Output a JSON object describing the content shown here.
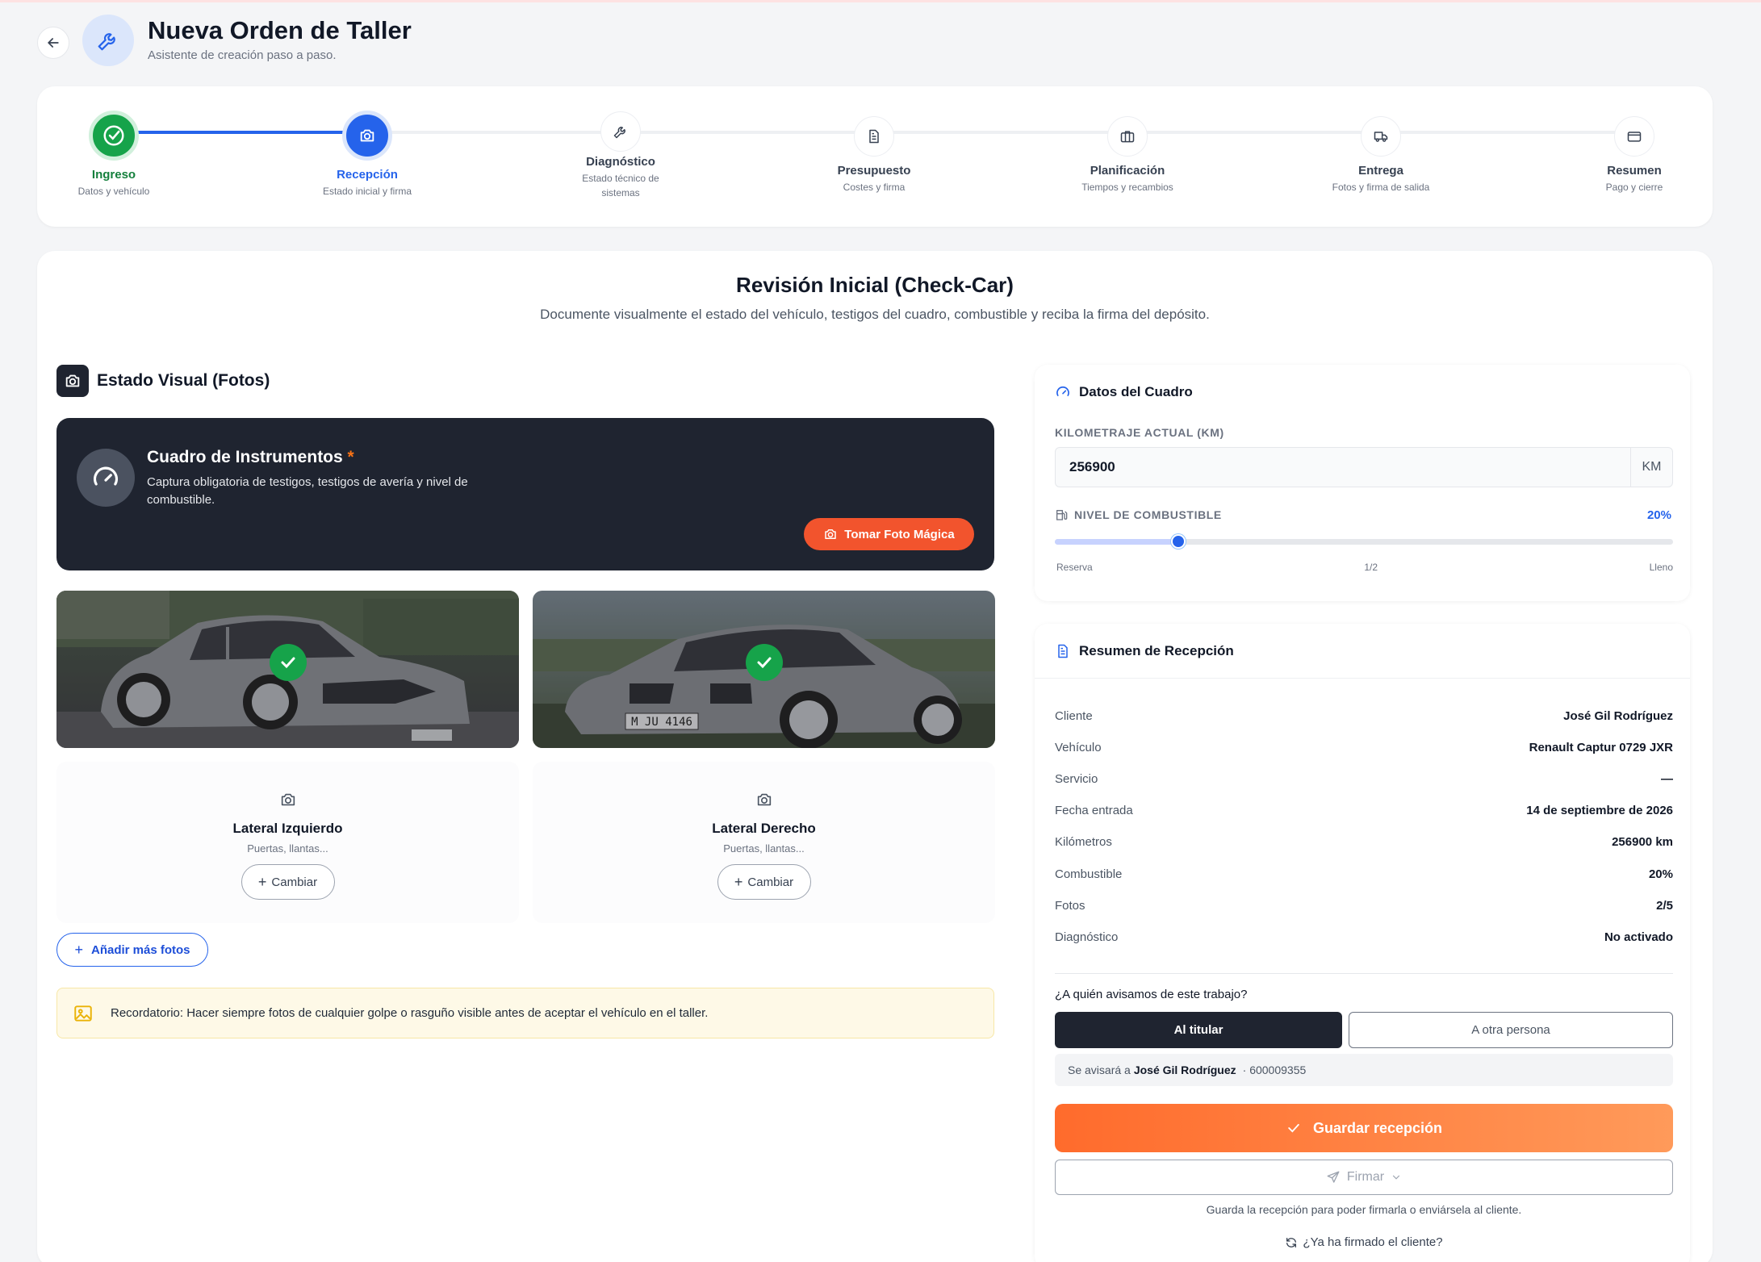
{
  "header": {
    "title": "Nueva Orden de Taller",
    "subtitle": "Asistente de creación paso a paso."
  },
  "steps": [
    {
      "label": "Ingreso",
      "desc": "Datos y vehículo",
      "state": "completed",
      "icon": "check-circle-icon"
    },
    {
      "label": "Recepción",
      "desc": "Estado inicial y firma",
      "state": "active",
      "icon": "camera-icon"
    },
    {
      "label": "Diagnóstico",
      "desc": "Estado técnico de sistemas",
      "state": "pending",
      "icon": "wrench-icon"
    },
    {
      "label": "Presupuesto",
      "desc": "Costes y firma",
      "state": "pending",
      "icon": "document-icon"
    },
    {
      "label": "Planificación",
      "desc": "Tiempos y recambios",
      "state": "pending",
      "icon": "briefcase-icon"
    },
    {
      "label": "Entrega",
      "desc": "Fotos y firma de salida",
      "state": "pending",
      "icon": "truck-icon"
    },
    {
      "label": "Resumen",
      "desc": "Pago y cierre",
      "state": "pending",
      "icon": "card-icon"
    }
  ],
  "main": {
    "title": "Revisión Inicial (Check-Car)",
    "subtitle": "Documente visualmente el estado del vehículo, testigos del cuadro, combustible y reciba la firma del depósito."
  },
  "photos_section": {
    "title": "Estado Visual (Fotos)",
    "dashboard": {
      "title": "Cuadro de Instrumentos",
      "required_mark": "*",
      "desc": "Captura obligatoria de testigos, testigos de avería y nivel de combustible.",
      "button": "Tomar Foto Mágica"
    },
    "slots": [
      {
        "title": "Lateral Izquierdo",
        "sub": "Puertas, llantas...",
        "button": "Cambiar"
      },
      {
        "title": "Lateral Derecho",
        "sub": "Puertas, llantas...",
        "button": "Cambiar"
      }
    ],
    "plate_text": "M JU 4146",
    "add_button": "Añadir más fotos",
    "reminder": "Recordatorio: Hacer siempre fotos de cualquier golpe o rasguño visible antes de aceptar el vehículo en el taller."
  },
  "dash_data": {
    "title": "Datos del Cuadro",
    "km_label": "KILOMETRAJE ACTUAL (KM)",
    "km_value": "256900",
    "km_unit": "KM",
    "fuel_label": "NIVEL DE COMBUSTIBLE",
    "fuel_pct_label": "20%",
    "fuel_fraction": 0.2,
    "ticks": [
      "Reserva",
      "1/2",
      "Lleno"
    ]
  },
  "summary": {
    "title": "Resumen de Recepción",
    "rows": [
      {
        "k": "Cliente",
        "v": "José Gil Rodríguez"
      },
      {
        "k": "Vehículo",
        "v": "Renault Captur 0729 JXR"
      },
      {
        "k": "Servicio",
        "v": "—"
      },
      {
        "k": "Fecha entrada",
        "v": "14 de septiembre de 2026"
      },
      {
        "k": "Kilómetros",
        "v": "256900 km"
      },
      {
        "k": "Combustible",
        "v": "20%"
      },
      {
        "k": "Fotos",
        "v": "2/5"
      },
      {
        "k": "Diagnóstico",
        "v": "No activado"
      }
    ],
    "ask": "¿A quién avisamos de este trabajo?",
    "option_a": "Al titular",
    "option_b": "A otra persona",
    "notice_prefix": "Se avisará a",
    "notice_name": "José Gil Rodríguez",
    "notice_phone": "· 600009355",
    "save_button": "Guardar recepción",
    "sign_button": "Firmar",
    "hint": "Guarda la recepción para poder firmarla o enviársela al cliente.",
    "signed_link": "¿Ya ha firmado el cliente?"
  },
  "colors": {
    "primary": "#2563eb",
    "success": "#16a34a",
    "accent": "#f2542d",
    "dark": "#1f2430"
  }
}
